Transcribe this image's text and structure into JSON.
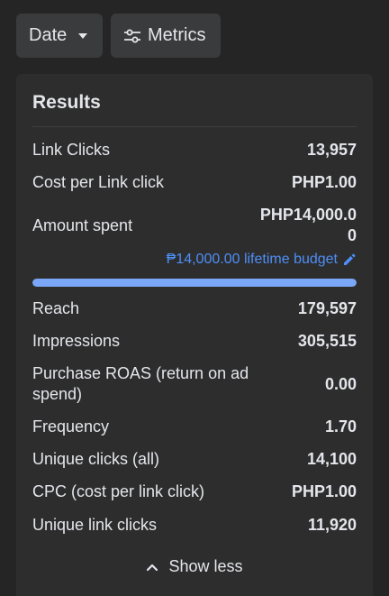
{
  "filters": {
    "date_label": "Date",
    "metrics_label": "Metrics"
  },
  "results": {
    "title": "Results",
    "link_clicks": {
      "label": "Link Clicks",
      "value": "13,957"
    },
    "cost_per_link_click": {
      "label": "Cost per Link click",
      "value": "PHP1.00"
    },
    "amount_spent": {
      "label": "Amount spent",
      "value": "PHP14,000.00"
    },
    "budget": {
      "label": "₱14,000.00 lifetime budget",
      "spent_fraction": 1.0
    },
    "reach": {
      "label": "Reach",
      "value": "179,597"
    },
    "impressions": {
      "label": "Impressions",
      "value": "305,515"
    },
    "purchase_roas": {
      "label": "Purchase ROAS (return on ad spend)",
      "value": "0.00"
    },
    "frequency": {
      "label": "Frequency",
      "value": "1.70"
    },
    "unique_clicks": {
      "label": "Unique clicks (all)",
      "value": "14,100"
    },
    "cpc": {
      "label": "CPC (cost per link click)",
      "value": "PHP1.00"
    },
    "unique_link_clicks": {
      "label": "Unique link clicks",
      "value": "11,920"
    },
    "show_less_label": "Show less"
  },
  "colors": {
    "background": "#252525",
    "card": "#2d2d2d",
    "accent": "#4e8ef7",
    "progress_fill": "#7aa7f8"
  },
  "icons": {
    "date_caret": "caret-down-icon",
    "metrics": "sliders-icon",
    "budget_edit": "pencil-icon",
    "show_less": "chevron-up-icon"
  }
}
